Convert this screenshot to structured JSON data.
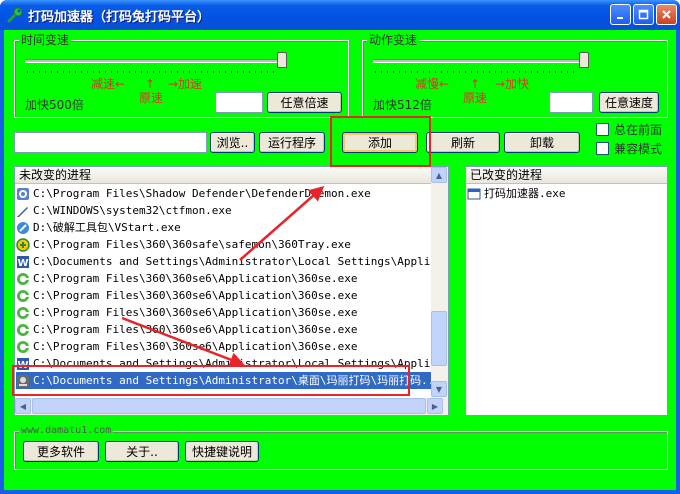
{
  "window": {
    "title": "打码加速器（打码兔打码平台）"
  },
  "time_group": {
    "label": "时间变速",
    "slow_label": "减速←",
    "up_arrow": "↑",
    "fast_label": "→加速",
    "original_label": "原速",
    "status": "加快500倍",
    "custom_button": "任意倍速",
    "input_value": "",
    "slider_level": 1.0
  },
  "action_group": {
    "label": "动作变速",
    "slow_label": "减慢←",
    "up_arrow": "↑",
    "fast_label": "→加快",
    "original_label": "原速",
    "status": "加快512倍",
    "custom_button": "任意速度",
    "input_value": "",
    "slider_level": 1.0
  },
  "toolbar": {
    "path_value": "",
    "browse_button": "浏览..",
    "run_button": "运行程序",
    "add_button": "添加",
    "refresh_button": "刷新",
    "unload_button": "卸载",
    "always_on_top_label": "总在前面",
    "compat_mode_label": "兼容模式"
  },
  "unchanged_list": {
    "header": "未改变的进程",
    "items": [
      {
        "icon": "shield-icon",
        "path": "C:\\Program Files\\Shadow Defender\\DefenderDaemon.exe"
      },
      {
        "icon": "pen-icon",
        "path": "C:\\WINDOWS\\system32\\ctfmon.exe"
      },
      {
        "icon": "tool-icon",
        "path": "D:\\破解工具包\\VStart.exe"
      },
      {
        "icon": "360-safe-icon",
        "path": "C:\\Program Files\\360\\360safe\\safemon\\360Tray.exe"
      },
      {
        "icon": "word-icon",
        "path": "C:\\Documents and Settings\\Administrator\\Local Settings\\Applicat..."
      },
      {
        "icon": "browser-icon",
        "path": "C:\\Program Files\\360\\360se6\\Application\\360se.exe"
      },
      {
        "icon": "browser-icon",
        "path": "C:\\Program Files\\360\\360se6\\Application\\360se.exe"
      },
      {
        "icon": "browser-icon",
        "path": "C:\\Program Files\\360\\360se6\\Application\\360se.exe"
      },
      {
        "icon": "browser-icon",
        "path": "C:\\Program Files\\360\\360se6\\Application\\360se.exe"
      },
      {
        "icon": "browser-icon",
        "path": "C:\\Program Files\\360\\360se6\\Application\\360se.exe"
      },
      {
        "icon": "word-icon",
        "path": "C:\\Documents and Settings\\Administrator\\Local Settings\\Applicat..."
      },
      {
        "icon": "app-icon",
        "path": "C:\\Documents and Settings\\Administrator\\桌面\\玛丽打码\\玛丽打码...",
        "selected": true
      }
    ]
  },
  "changed_list": {
    "header": "已改变的进程",
    "items": [
      {
        "icon": "window-icon",
        "path": "打码加速器.exe"
      }
    ]
  },
  "footer": {
    "label": "www.damatu1.com",
    "more_software_button": "更多软件",
    "about_button": "关于..",
    "shortcut_help_button": "快捷键说明"
  },
  "colors": {
    "background": "#00ff00",
    "titlebar": "#0054e3",
    "annotation": "#e8232a",
    "selection": "#316ac5"
  }
}
